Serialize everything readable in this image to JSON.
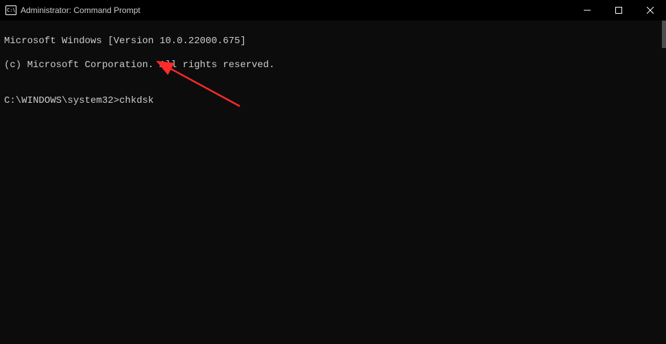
{
  "titlebar": {
    "title": "Administrator: Command Prompt"
  },
  "terminal": {
    "line1": "Microsoft Windows [Version 10.0.22000.675]",
    "line2": "(c) Microsoft Corporation. All rights reserved.",
    "blank": "",
    "prompt": "C:\\WINDOWS\\system32>",
    "command": "chkdsk"
  }
}
